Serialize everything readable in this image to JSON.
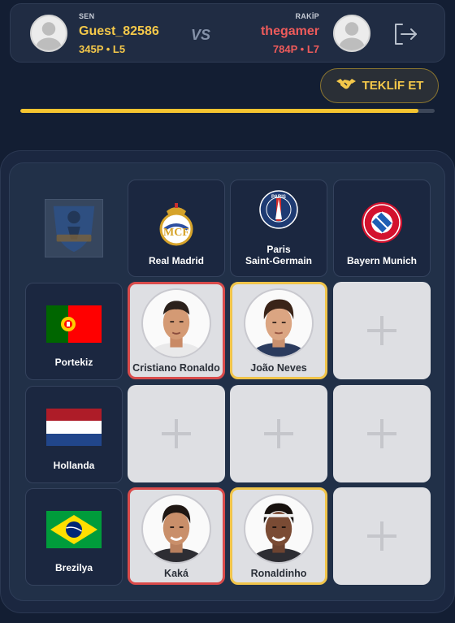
{
  "header": {
    "left_player": {
      "role": "SEN",
      "name": "Guest_82586",
      "stats": "345P • L5"
    },
    "vs": "VS",
    "right_player": {
      "role": "RAKİP",
      "name": "thegamer",
      "stats": "784P • L7"
    },
    "icons": {
      "avatar": "user-avatar-icon",
      "logout": "logout-icon"
    }
  },
  "offer_button": {
    "label": "TEKLİF ET",
    "icon": "handshake-icon"
  },
  "progress": {
    "fraction": 0.96
  },
  "board": {
    "columns": [
      {
        "name": "Real Madrid",
        "icon": "real-madrid-crest"
      },
      {
        "name": "Paris\nSaint-Germain",
        "icon": "psg-crest"
      },
      {
        "name": "Bayern Munich",
        "icon": "bayern-munich-crest"
      }
    ],
    "rows": [
      {
        "name": "Portekiz",
        "icon": "portugal-flag"
      },
      {
        "name": "Hollanda",
        "icon": "netherlands-flag"
      },
      {
        "name": "Brezilya",
        "icon": "brazil-flag"
      }
    ],
    "cells": [
      [
        {
          "player": "Cristiano Ronaldo",
          "owner": "red"
        },
        {
          "player": "João Neves",
          "owner": "gold"
        },
        null
      ],
      [
        null,
        null,
        null
      ],
      [
        {
          "player": "Kaká",
          "owner": "red"
        },
        {
          "player": "Ronaldinho",
          "owner": "gold"
        },
        null
      ]
    ]
  },
  "colors": {
    "background": "#131e33",
    "player_gold": "#f4c84a",
    "opponent_red": "#ee5b5b",
    "empty_cell": "#dedfe3"
  }
}
